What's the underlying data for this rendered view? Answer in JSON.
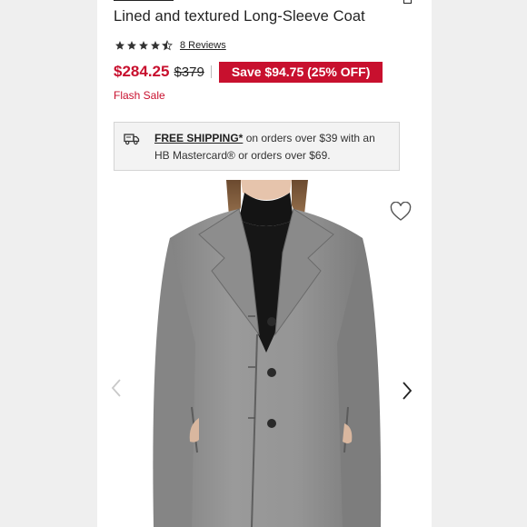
{
  "product": {
    "title": "Lined and textured Long-Sleeve Coat",
    "rating": 4.5,
    "rating_max": 5,
    "reviews_label": "8 Reviews",
    "price": "$284.25",
    "original_price": "$379",
    "save_label": "Save $94.75 (25% OFF)",
    "flash_label": "Flash Sale"
  },
  "shipping": {
    "strong": "FREE SHIPPING*",
    "text": " on orders over $39 with an HB Mastercard® or orders over $69.",
    "icon": "truck-icon"
  },
  "gallery": {
    "prev_icon": "chevron-left-icon",
    "next_icon": "chevron-right-icon",
    "favorite_icon": "heart-icon"
  },
  "colors": {
    "sale_red": "#c8102e",
    "text": "#222222",
    "page_bg": "#efefef"
  }
}
